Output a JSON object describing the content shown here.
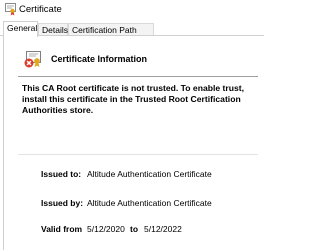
{
  "window": {
    "title": "Certificate",
    "icon": "certificate-icon"
  },
  "tabs": [
    {
      "label": "General",
      "active": true
    },
    {
      "label": "Details",
      "active": false
    },
    {
      "label": "Certification Path",
      "active": false
    }
  ],
  "info": {
    "icon": "untrusted-certificate-icon",
    "title": "Certificate Information",
    "warning": "This CA Root certificate is not trusted. To enable trust, install this certificate in the Trusted Root Certification Authorities store."
  },
  "fields": {
    "issued_to_label": "Issued to:",
    "issued_to_value": "Altitude Authentication Certificate",
    "issued_by_label": "Issued by:",
    "issued_by_value": "Altitude Authentication Certificate",
    "valid_from_label": "Valid from",
    "valid_from_value": "5/12/2020",
    "valid_to_label": "to",
    "valid_to_value": "5/12/2022"
  },
  "colors": {
    "error_red": "#d83b2b",
    "ribbon_gold": "#e0a71a"
  }
}
